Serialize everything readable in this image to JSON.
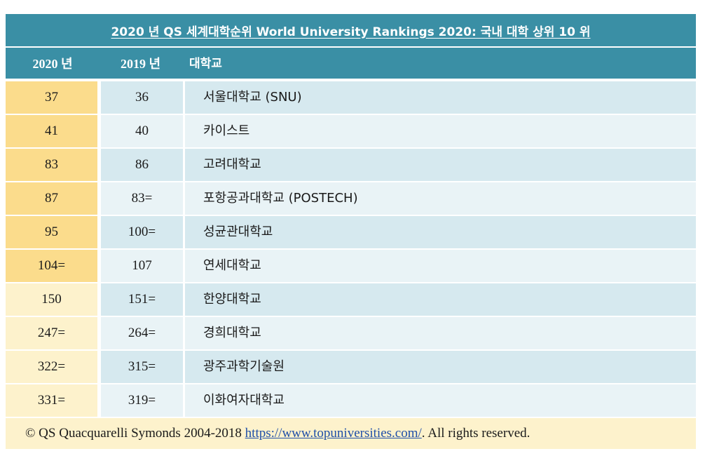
{
  "title": "2020 년 QS 세계대학순위 World University Rankings 2020: 국내 대학 상위 10 위",
  "header": {
    "col_2020": "2020 년",
    "col_2019": "2019 년",
    "col_university": "대학교"
  },
  "colors": {
    "header_bg": "#3a8fa5",
    "rank_top_bg": "#fbdc8c",
    "rank_other_bg": "#fdf2cc",
    "row_bg": "#d6e9ef",
    "row_alt_bg": "#e9f3f6",
    "footer_bg": "#fdf2cc",
    "link": "#1f4fa8"
  },
  "rows": [
    {
      "rank_2020": "37",
      "rank_2019": "36",
      "university": "서울대학교 (SNU)",
      "highlight": true
    },
    {
      "rank_2020": "41",
      "rank_2019": "40",
      "university": "카이스트",
      "highlight": true
    },
    {
      "rank_2020": "83",
      "rank_2019": "86",
      "university": "고려대학교",
      "highlight": true
    },
    {
      "rank_2020": "87",
      "rank_2019": "83=",
      "university": "포항공과대학교 (POSTECH)",
      "highlight": true
    },
    {
      "rank_2020": "95",
      "rank_2019": "100=",
      "university": "성균관대학교",
      "highlight": true
    },
    {
      "rank_2020": "104=",
      "rank_2019": "107",
      "university": "연세대학교",
      "highlight": true
    },
    {
      "rank_2020": "150",
      "rank_2019": "151=",
      "university": "한양대학교",
      "highlight": false
    },
    {
      "rank_2020": "247=",
      "rank_2019": "264=",
      "university": "경희대학교",
      "highlight": false
    },
    {
      "rank_2020": "322=",
      "rank_2019": "315=",
      "university": "광주과학기술원",
      "highlight": false
    },
    {
      "rank_2020": "331=",
      "rank_2019": "319=",
      "university": "이화여자대학교",
      "highlight": false
    }
  ],
  "footer": {
    "prefix": "© QS Quacquarelli Symonds 2004-2018 ",
    "link_text": "https://www.topuniversities.com/",
    "suffix": ". All rights reserved."
  }
}
